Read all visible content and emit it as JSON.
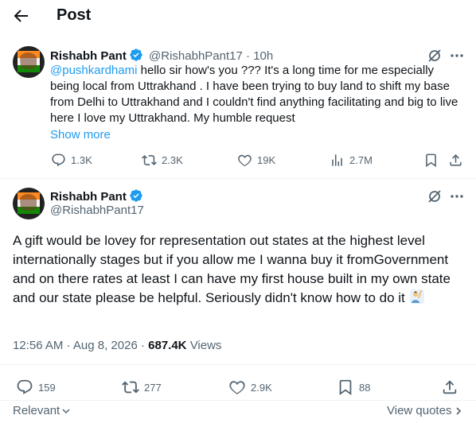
{
  "header": {
    "title": "Post"
  },
  "tweet1": {
    "name": "Rishabh Pant",
    "handle": "@RishabhPant17",
    "dot": "·",
    "time": "10h",
    "mention": "@pushkardhami",
    "text": " hello sir how's you ???  It's a long time for me especially being local from Uttrakhand . I have been trying to buy land to shift my base from Delhi to Uttrakhand and I couldn't find anything facilitating and big to live here I love my Uttrakhand. My humble request",
    "show_more": "Show more",
    "stats": {
      "replies": "1.3K",
      "reposts": "2.3K",
      "likes": "19K",
      "views": "2.7M"
    }
  },
  "tweet2": {
    "name": "Rishabh Pant",
    "handle": "@RishabhPant17",
    "text": "A gift would be lovey for representation out states at the highest level internationally stages but if you allow me I wanna buy it fromGovernment and on there  rates at least I can have my first house built in my own state and our state please be helpful.  Seriously didn't know how to do it",
    "time": "12:56 AM · Aug 8, 2026",
    "dot": "·",
    "views_count": "687.4K",
    "views_label": "Views",
    "stats": {
      "replies": "159",
      "reposts": "277",
      "likes": "2.9K",
      "bookmarks": "88"
    }
  },
  "footer": {
    "relevant": "Relevant",
    "view_quotes": "View quotes"
  },
  "colors": {
    "accent": "#1d9bf0",
    "muted": "#536471",
    "text": "#0f1419",
    "divider": "#eff3f4",
    "verified": "#1d9bf0"
  },
  "icons": [
    "back-arrow-icon",
    "verified-badge-icon",
    "grok-icon",
    "more-icon",
    "reply-icon",
    "repost-icon",
    "like-icon",
    "views-icon",
    "bookmark-icon",
    "share-icon",
    "chevron-down-icon",
    "chevron-right-icon",
    "raising-hand-emoji"
  ]
}
